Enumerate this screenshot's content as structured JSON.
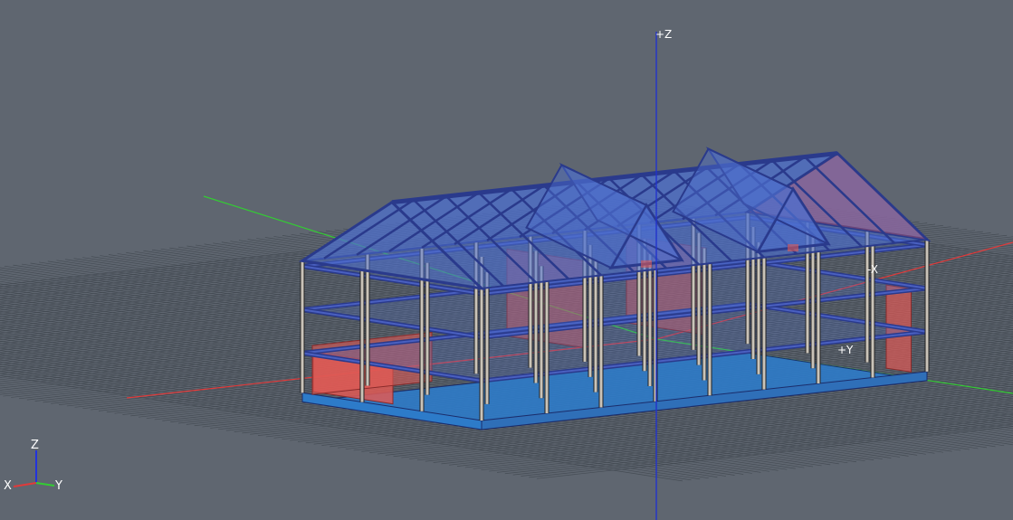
{
  "viewport": {
    "background_color": "#5f6670",
    "grid_color": "#3f464e",
    "grid_visible": true
  },
  "axes": {
    "z_positive_label": "+Z",
    "x_negative_label": "-X",
    "y_positive_label": "+Y",
    "x_color": "#e03a3a",
    "y_color": "#33cc33",
    "z_color": "#2233cc"
  },
  "orientation_triad": {
    "z_label": "Z",
    "x_label": "X",
    "y_label": "Y"
  },
  "model": {
    "frame_color": "#2a3a8c",
    "wall_color": "#e05a55",
    "glass_color": "#4d6fcf",
    "slab_color": "#2d7bc9",
    "column_color": "#c9c3b8"
  }
}
